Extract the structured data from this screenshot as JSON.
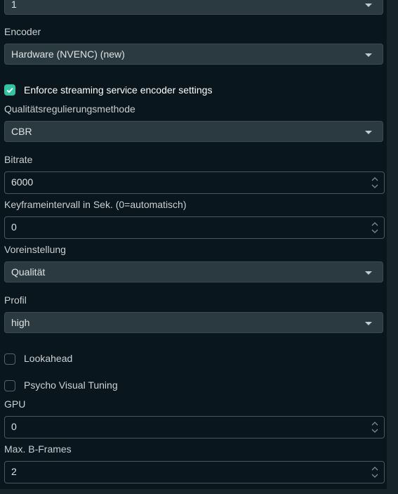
{
  "fields": {
    "top_select": {
      "value": "1"
    },
    "encoder": {
      "label": "Encoder",
      "value": "Hardware (NVENC) (new)"
    },
    "enforce": {
      "label": "Enforce streaming service encoder settings",
      "checked": true
    },
    "rate_control": {
      "label": "Qualitätsregulierungsmethode",
      "value": "CBR"
    },
    "bitrate": {
      "label": "Bitrate",
      "value": "6000"
    },
    "keyframe": {
      "label": "Keyframeintervall in Sek. (0=automatisch)",
      "value": "0"
    },
    "preset": {
      "label": "Voreinstellung",
      "value": "Qualität"
    },
    "profile": {
      "label": "Profil",
      "value": "high"
    },
    "lookahead": {
      "label": "Lookahead",
      "checked": false
    },
    "psycho": {
      "label": "Psycho Visual Tuning",
      "checked": false
    },
    "gpu": {
      "label": "GPU",
      "value": "0"
    },
    "bframes": {
      "label": "Max. B-Frames",
      "value": "2"
    }
  },
  "colors": {
    "accent": "#31c3a2",
    "background": "#09161d",
    "select_bg": "#2b3a40"
  }
}
